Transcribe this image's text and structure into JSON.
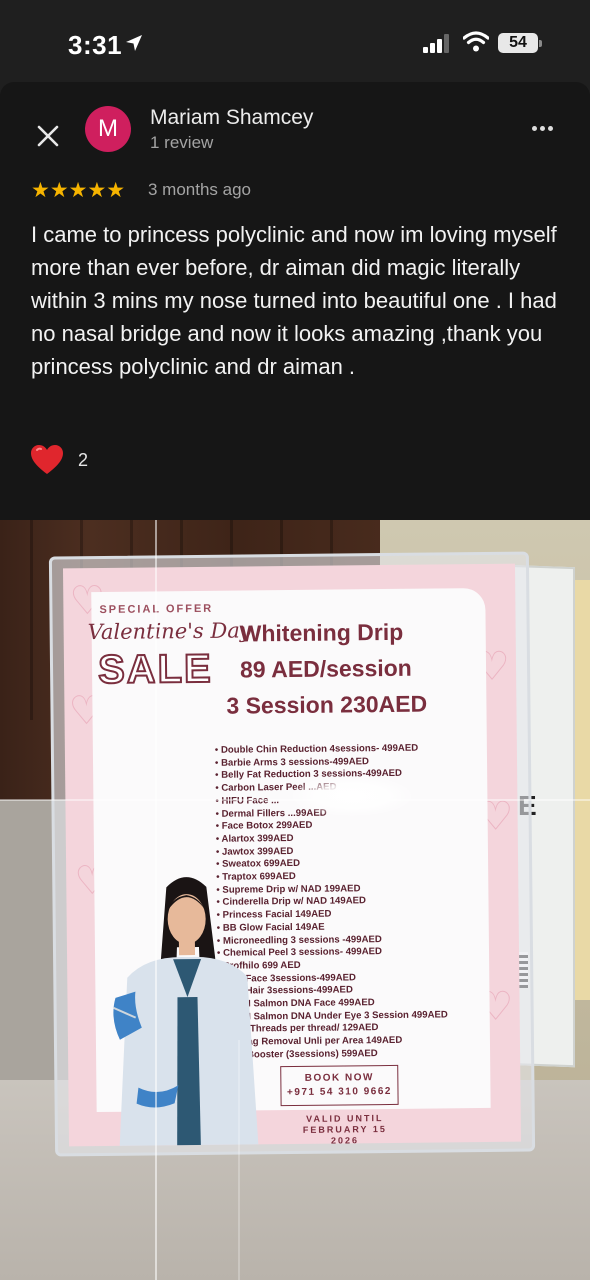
{
  "status_bar": {
    "time": "3:31",
    "battery": "54",
    "icons": [
      "location-arrow-icon",
      "cellular-signal-icon",
      "wifi-icon",
      "battery-icon"
    ]
  },
  "review": {
    "reviewer_initial": "M",
    "reviewer_name": "Mariam Shamcey",
    "review_count": "1 review",
    "rating": 5,
    "stars": "★★★★★",
    "date": "3 months ago",
    "text": "I came to princess polyclinic and now im loving myself more than ever before,  dr aiman did magic literally within 3 mins my nose turned into beautiful one . I had no nasal bridge and now it looks amazing ,thank you princess polyclinic and dr aiman .",
    "reaction_count": "2",
    "avatar_color": "#cf1f5e",
    "star_color": "#f6b400"
  },
  "poster": {
    "special_offer": "SPECIAL OFFER",
    "valentines": "Valentine's Day",
    "sale": "SALE",
    "headline": "Whitening Drip",
    "price_single": "89 AED/session",
    "price_bundle": "3 Session 230AED",
    "services": [
      "Double Chin Reduction 4sessions- 499AED",
      "Barbie Arms  3 sessions-499AED",
      "Belly Fat Reduction 3 sessions-499AED",
      "Carbon Laser Peel ...AED",
      "HIFU Face ...",
      "Dermal Fillers ...99AED",
      "Face Botox 299AED",
      "Alartox 399AED",
      "Jawtox 399AED",
      "Sweatox 699AED",
      "Traptox 699AED",
      "Supreme Drip  w/ NAD  199AED",
      "Cinderella Drip w/ NAD 149AED",
      "Princess Facial 149AED",
      "BB Glow  Facial 149AE",
      "Microneedling 3 sessions -499AED",
      "Chemical Peel 3 sessions- 499AED",
      "Profhilo 699 AED",
      "PRP Face 3sessions-499AED",
      "PRP Hair 3sessions-499AED",
      "PDRN Salmon DNA Face 499AED",
      "PDRN Salmon DNA Under Eye 3 Session 499AED",
      "Nose Threads per thread/ 129AED",
      "Skintag Removal Unli per Area 149AED",
      "Skin Booster (3sessions) 599AED"
    ],
    "book_now": "BOOK NOW",
    "phone": "+971 54 310 9662",
    "valid_until": "VALID UNTIL",
    "valid_date": "FEBRUARY 15 2026",
    "side_letter": "E"
  }
}
